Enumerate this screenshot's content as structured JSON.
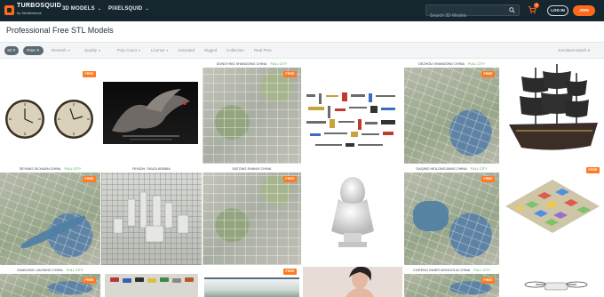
{
  "brand": {
    "name": "TURBOSQUID",
    "sub": "by Shutterstock"
  },
  "nav": [
    {
      "label": "3D MODELS"
    },
    {
      "label": "PIXELSQUID"
    }
  ],
  "search": {
    "placeholder": "Search 3D Models"
  },
  "cart": {
    "count": "0"
  },
  "auth": {
    "login": "LOG IN",
    "join": "JOIN"
  },
  "page": {
    "title": "Professional Free STL Models"
  },
  "filters": {
    "chip_stl": "stl ✕",
    "chip_free": "Free ✕",
    "items": [
      "Remesh",
      "Quality",
      "Poly Count",
      "License",
      "Animated",
      "Rigged",
      "Collection",
      "Real Prev"
    ],
    "sort": "Sort:Best Match"
  },
  "products": [
    {
      "title": "",
      "free": "FREE"
    },
    {
      "title": "",
      "free": ""
    },
    {
      "title": "DONGYING SHANDONG CHINA",
      "tag": "FULL CITY",
      "free": "FREE"
    },
    {
      "title": "",
      "free": ""
    },
    {
      "title": "DEZHOU SHANDONG CHINA",
      "tag": "FULL CITY",
      "free": "FREE"
    },
    {
      "title": "",
      "free": ""
    },
    {
      "title": "DEYANG SICHUAN CHINA",
      "tag": "FULL CITY",
      "free": "FREE"
    },
    {
      "title": "RIYADH, SAUDI ARABIA",
      "tag": "",
      "free": ""
    },
    {
      "title": "DATONG SHANXI CHINA",
      "tag": "",
      "free": "FREE"
    },
    {
      "title": "",
      "free": ""
    },
    {
      "title": "DAQING HEILONGJIANG CHINA",
      "tag": "FULL CITY",
      "free": "FREE"
    },
    {
      "title": "",
      "free": "FREE"
    },
    {
      "title": "DANDONG LIAONING CHINA",
      "tag": "FULL CITY",
      "free": "FREE"
    },
    {
      "title": "",
      "free": ""
    },
    {
      "title": "",
      "free": "FREE"
    },
    {
      "title": "",
      "free": ""
    },
    {
      "title": "CHIFENG INNER MONGOLIA CHINA",
      "tag": "FULL CITY",
      "free": "FREE"
    },
    {
      "title": "",
      "free": ""
    }
  ]
}
